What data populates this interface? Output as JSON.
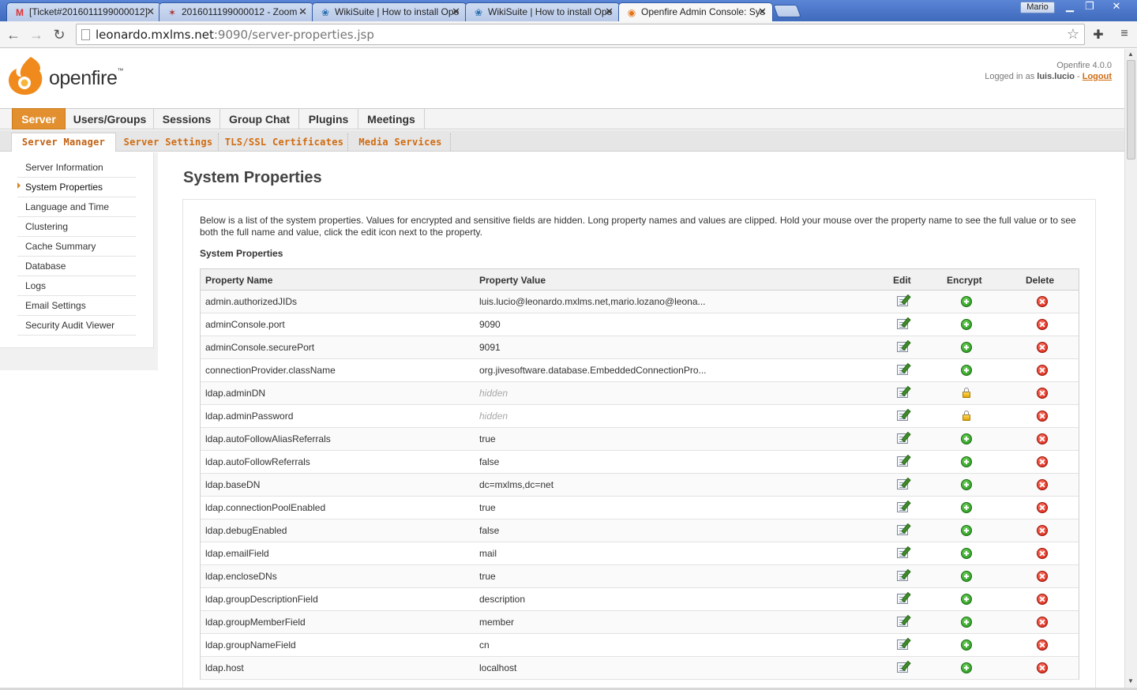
{
  "browser": {
    "tabs": [
      {
        "title": "[Ticket#2016011199000012]",
        "icon": "gmail-icon",
        "active": false
      },
      {
        "title": "2016011199000012 - Zoom -",
        "icon": "zoom-icon",
        "active": false
      },
      {
        "title": "WikiSuite | How to install Ope",
        "icon": "wiki-icon",
        "active": false
      },
      {
        "title": "WikiSuite | How to install Ope",
        "icon": "wiki-icon",
        "active": false
      },
      {
        "title": "Openfire Admin Console: Sys",
        "icon": "openfire-icon",
        "active": true
      }
    ],
    "user": "Mario",
    "url_host": "leonardo.mxlms.net",
    "url_path": ":9090/server-properties.jsp"
  },
  "header": {
    "logo_text": "openfire",
    "version": "Openfire 4.0.0",
    "logged_in_prefix": "Logged in as ",
    "username": "luis.lucio",
    "separator": " - ",
    "logout": "Logout"
  },
  "mainnav": [
    "Server",
    "Users/Groups",
    "Sessions",
    "Group Chat",
    "Plugins",
    "Meetings"
  ],
  "subnav": [
    "Server Manager",
    "Server Settings",
    "TLS/SSL Certificates",
    "Media Services"
  ],
  "sidebar": [
    "Server Information",
    "System Properties",
    "Language and Time",
    "Clustering",
    "Cache Summary",
    "Database",
    "Logs",
    "Email Settings",
    "Security Audit Viewer"
  ],
  "page": {
    "title": "System Properties",
    "intro": "Below is a list of the system properties. Values for encrypted and sensitive fields are hidden. Long property names and values are clipped. Hold your mouse over the property name to see the full value or to see both the full name and value, click the edit icon next to the property.",
    "section_title": "System Properties"
  },
  "table": {
    "headers": {
      "name": "Property Name",
      "value": "Property Value",
      "edit": "Edit",
      "encrypt": "Encrypt",
      "delete": "Delete"
    },
    "rows": [
      {
        "name": "admin.authorizedJIDs",
        "value": "luis.lucio@leonardo.mxlms.net,mario.lozano@leona...",
        "encrypted": false
      },
      {
        "name": "adminConsole.port",
        "value": "9090",
        "encrypted": false
      },
      {
        "name": "adminConsole.securePort",
        "value": "9091",
        "encrypted": false
      },
      {
        "name": "connectionProvider.className",
        "value": "org.jivesoftware.database.EmbeddedConnectionPro...",
        "encrypted": false
      },
      {
        "name": "ldap.adminDN",
        "value": "hidden",
        "encrypted": true
      },
      {
        "name": "ldap.adminPassword",
        "value": "hidden",
        "encrypted": true
      },
      {
        "name": "ldap.autoFollowAliasReferrals",
        "value": "true",
        "encrypted": false
      },
      {
        "name": "ldap.autoFollowReferrals",
        "value": "false",
        "encrypted": false
      },
      {
        "name": "ldap.baseDN",
        "value": "dc=mxlms,dc=net",
        "encrypted": false
      },
      {
        "name": "ldap.connectionPoolEnabled",
        "value": "true",
        "encrypted": false
      },
      {
        "name": "ldap.debugEnabled",
        "value": "false",
        "encrypted": false
      },
      {
        "name": "ldap.emailField",
        "value": "mail",
        "encrypted": false
      },
      {
        "name": "ldap.encloseDNs",
        "value": "true",
        "encrypted": false
      },
      {
        "name": "ldap.groupDescriptionField",
        "value": "description",
        "encrypted": false
      },
      {
        "name": "ldap.groupMemberField",
        "value": "member",
        "encrypted": false
      },
      {
        "name": "ldap.groupNameField",
        "value": "cn",
        "encrypted": false
      },
      {
        "name": "ldap.host",
        "value": "localhost",
        "encrypted": false
      }
    ]
  },
  "colors": {
    "accent": "#e2902f",
    "link": "#d06b10",
    "chrome": "#4a76c8"
  }
}
